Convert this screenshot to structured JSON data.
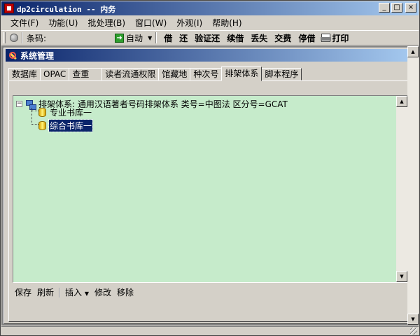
{
  "window": {
    "title": "dp2circulation -- 内务",
    "buttons": {
      "minimize": "_",
      "maximize": "□",
      "close": "×"
    }
  },
  "menu": [
    {
      "label": "文件(F)"
    },
    {
      "label": "功能(U)"
    },
    {
      "label": "批处理(B)"
    },
    {
      "label": "窗口(W)"
    },
    {
      "label": "外观(I)"
    },
    {
      "label": "帮助(H)"
    }
  ],
  "toolbar": {
    "barcode_label": "条码:",
    "barcode_value": "",
    "auto_label": "自动",
    "buttons": [
      "借",
      "还",
      "验证还",
      "续借",
      "丢失",
      "交费",
      "停借"
    ],
    "print_label": "打印"
  },
  "child_window": {
    "title": "系统管理"
  },
  "tabs": [
    "数据库",
    "OPAC",
    "查重",
    "读者流通权限",
    "馆藏地",
    "种次号",
    "排架体系",
    "脚本程序"
  ],
  "active_tab": "排架体系",
  "tree": {
    "root_label": "排架体系: 通用汉语著者号码排架体系 类号=中图法 区分号=GCAT",
    "children": [
      {
        "label": "专业书库一",
        "selected": false
      },
      {
        "label": "综合书库一",
        "selected": true
      }
    ]
  },
  "actions": {
    "save": "保存",
    "refresh": "刷新",
    "insert": "插入",
    "modify": "修改",
    "delete": "移除"
  },
  "colors": {
    "tree_background": "#c6ebcb",
    "titlebar": "#0a246a",
    "selection": "#0a246a"
  },
  "icons": {
    "app": "app-icon",
    "tree_root": "network-icon",
    "tree_node": "database-icon",
    "child": "wrench-icon"
  }
}
